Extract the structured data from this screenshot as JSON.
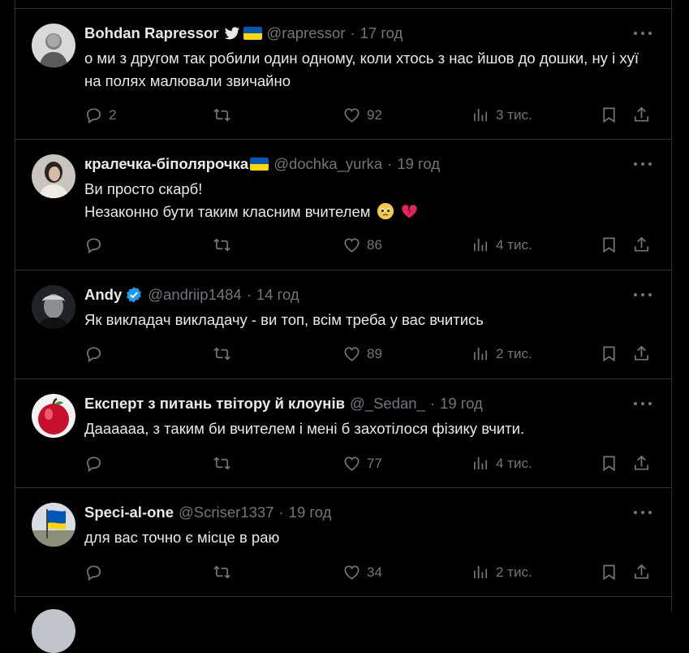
{
  "tweets": [
    {
      "name": "Bohdan Rapressor",
      "handle": "@rapressor",
      "time": "17 год",
      "lines": [
        "о ми з другом так робили один одному, коли хтось з нас йшов до дошки, ну і хуї на полях малювали звичайно"
      ],
      "replies": "2",
      "retweets": "",
      "likes": "92",
      "views": "3 тис."
    },
    {
      "name": "кралечка-біполярочка",
      "handle": "@dochka_yurka",
      "time": "19 год",
      "lines": [
        "Ви просто скарб!",
        "Незаконно бути таким класним вчителем"
      ],
      "emoji": [
        "pleading-face-emoji",
        "broken-heart-emoji"
      ],
      "replies": "",
      "retweets": "",
      "likes": "86",
      "views": "4 тис."
    },
    {
      "name": "Andy",
      "handle": "@andriip1484",
      "time": "14 год",
      "lines": [
        "Як викладач викладачу - ви топ, всім треба у вас вчитись"
      ],
      "replies": "",
      "retweets": "",
      "likes": "89",
      "views": "2 тис."
    },
    {
      "name": "Експерт з питань твітору й клоунів",
      "handle": "@_Sedan_",
      "time": "19 год",
      "lines": [
        "Даааааа, з таким би вчителем і мені б захотілося фізику вчити."
      ],
      "replies": "",
      "retweets": "",
      "likes": "77",
      "views": "4 тис."
    },
    {
      "name": "Speci-al-one",
      "handle": "@Scriser1337",
      "time": "19 год",
      "lines": [
        "для вас точно є місце в раю"
      ],
      "replies": "",
      "retweets": "",
      "likes": "34",
      "views": "2 тис."
    }
  ],
  "colors": {
    "background": "#000000",
    "text": "#e7e9ea",
    "muted": "#71767b",
    "divider": "#2f3336",
    "verified": "#1d9bf0"
  }
}
